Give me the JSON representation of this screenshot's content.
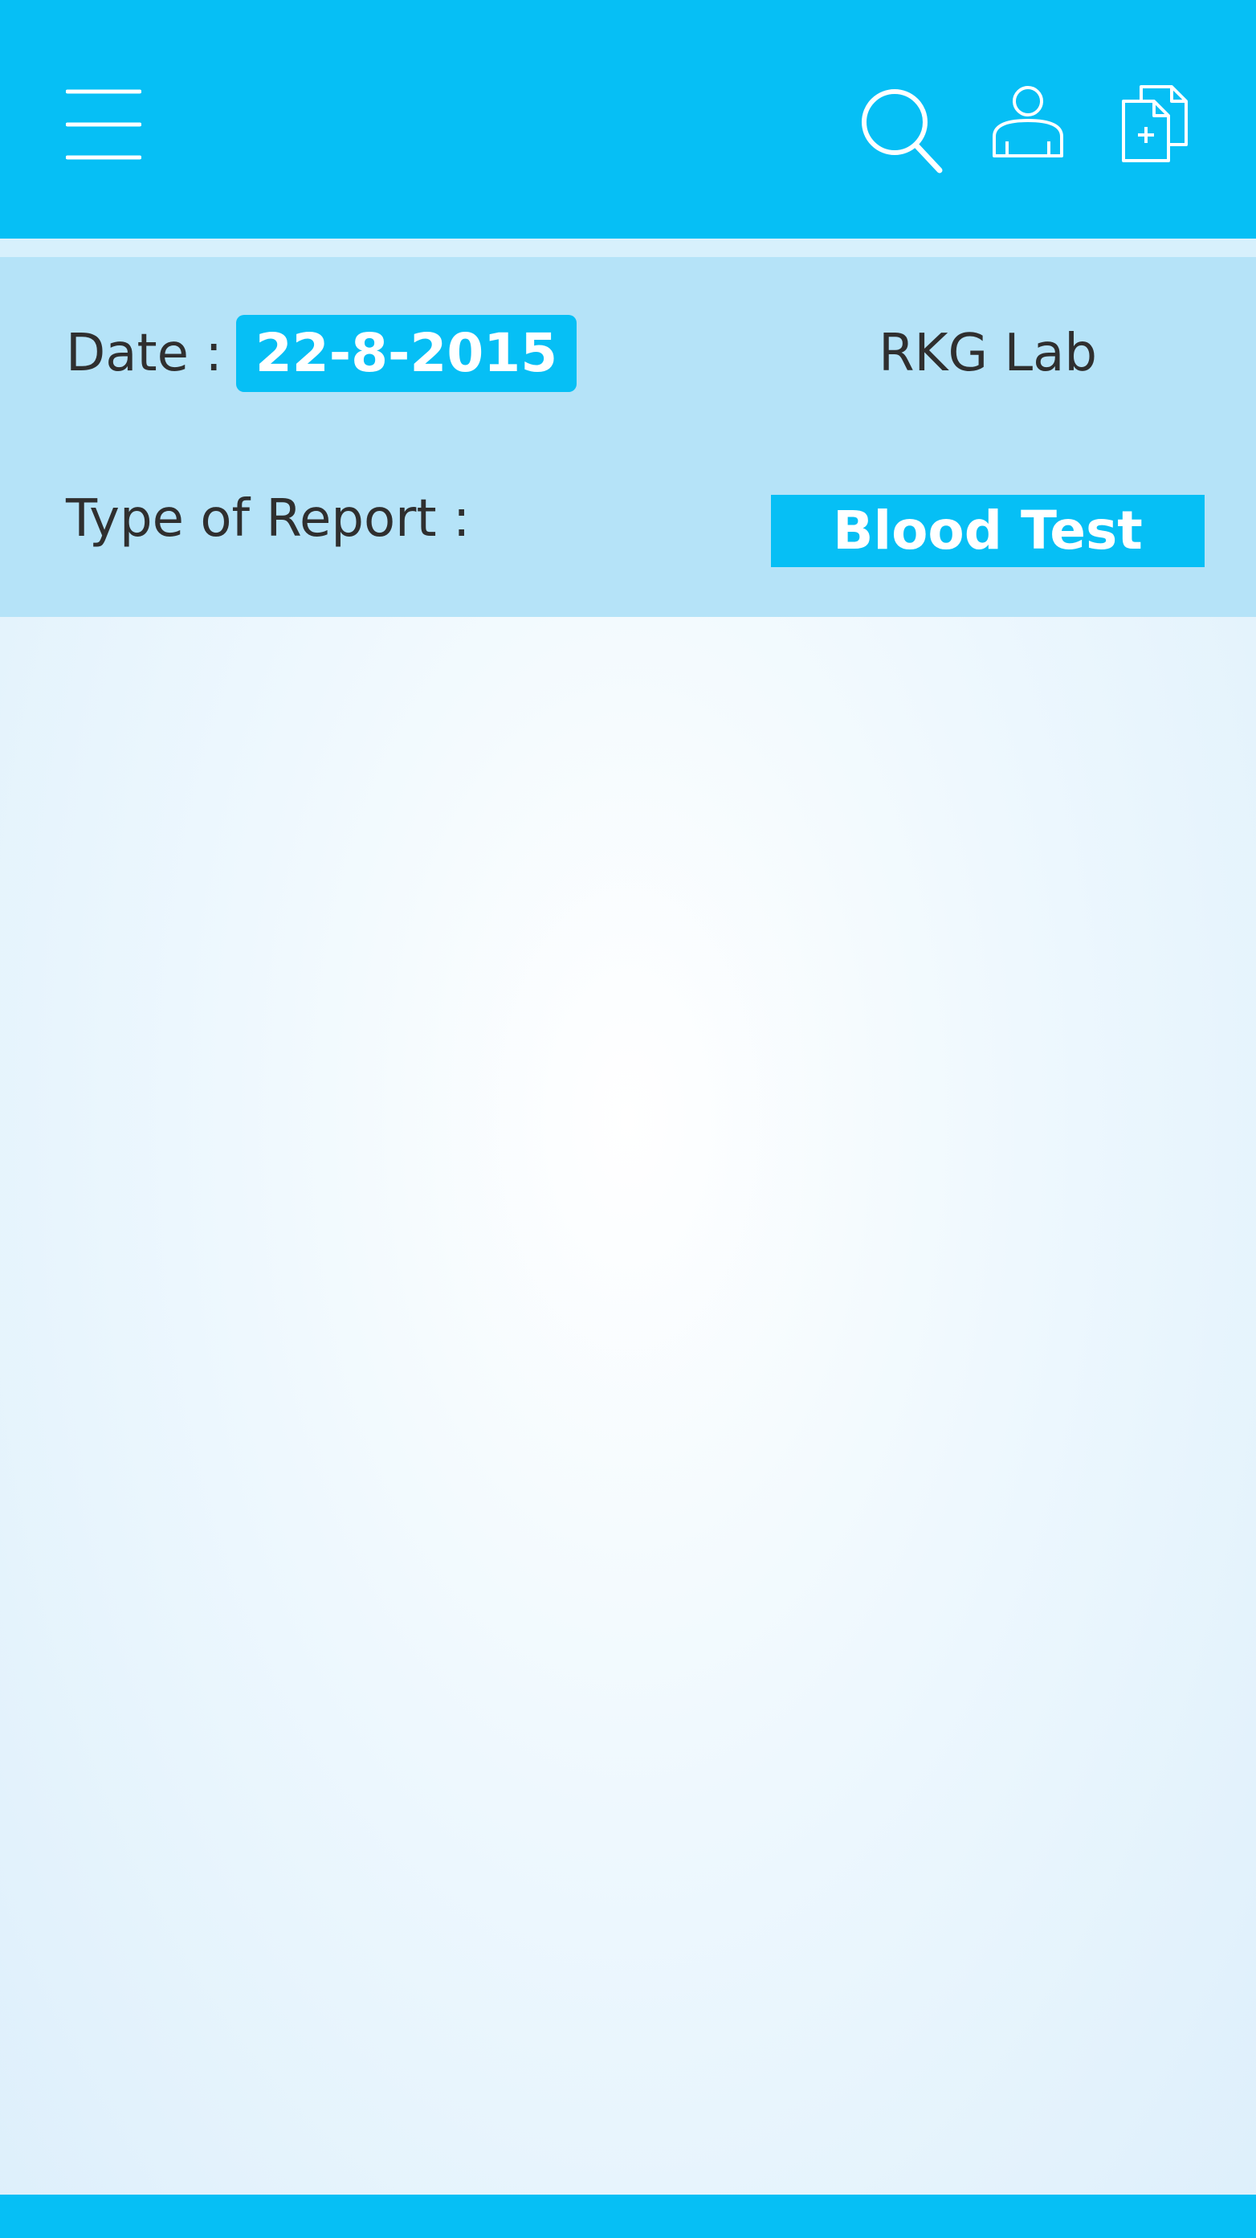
{
  "colors": {
    "accent": "#06bff5",
    "panel": "#b5e3f8",
    "text": "#2f2f2f",
    "on_accent": "#ffffff"
  },
  "header": {
    "icons": [
      "menu-icon",
      "search-icon",
      "user-icon",
      "add-document-icon"
    ]
  },
  "report": {
    "date_label": "Date :",
    "date_value": "22-8-2015",
    "lab_name": "RKG Lab",
    "type_label": "Type of Report :",
    "type_value": "Blood Test"
  }
}
